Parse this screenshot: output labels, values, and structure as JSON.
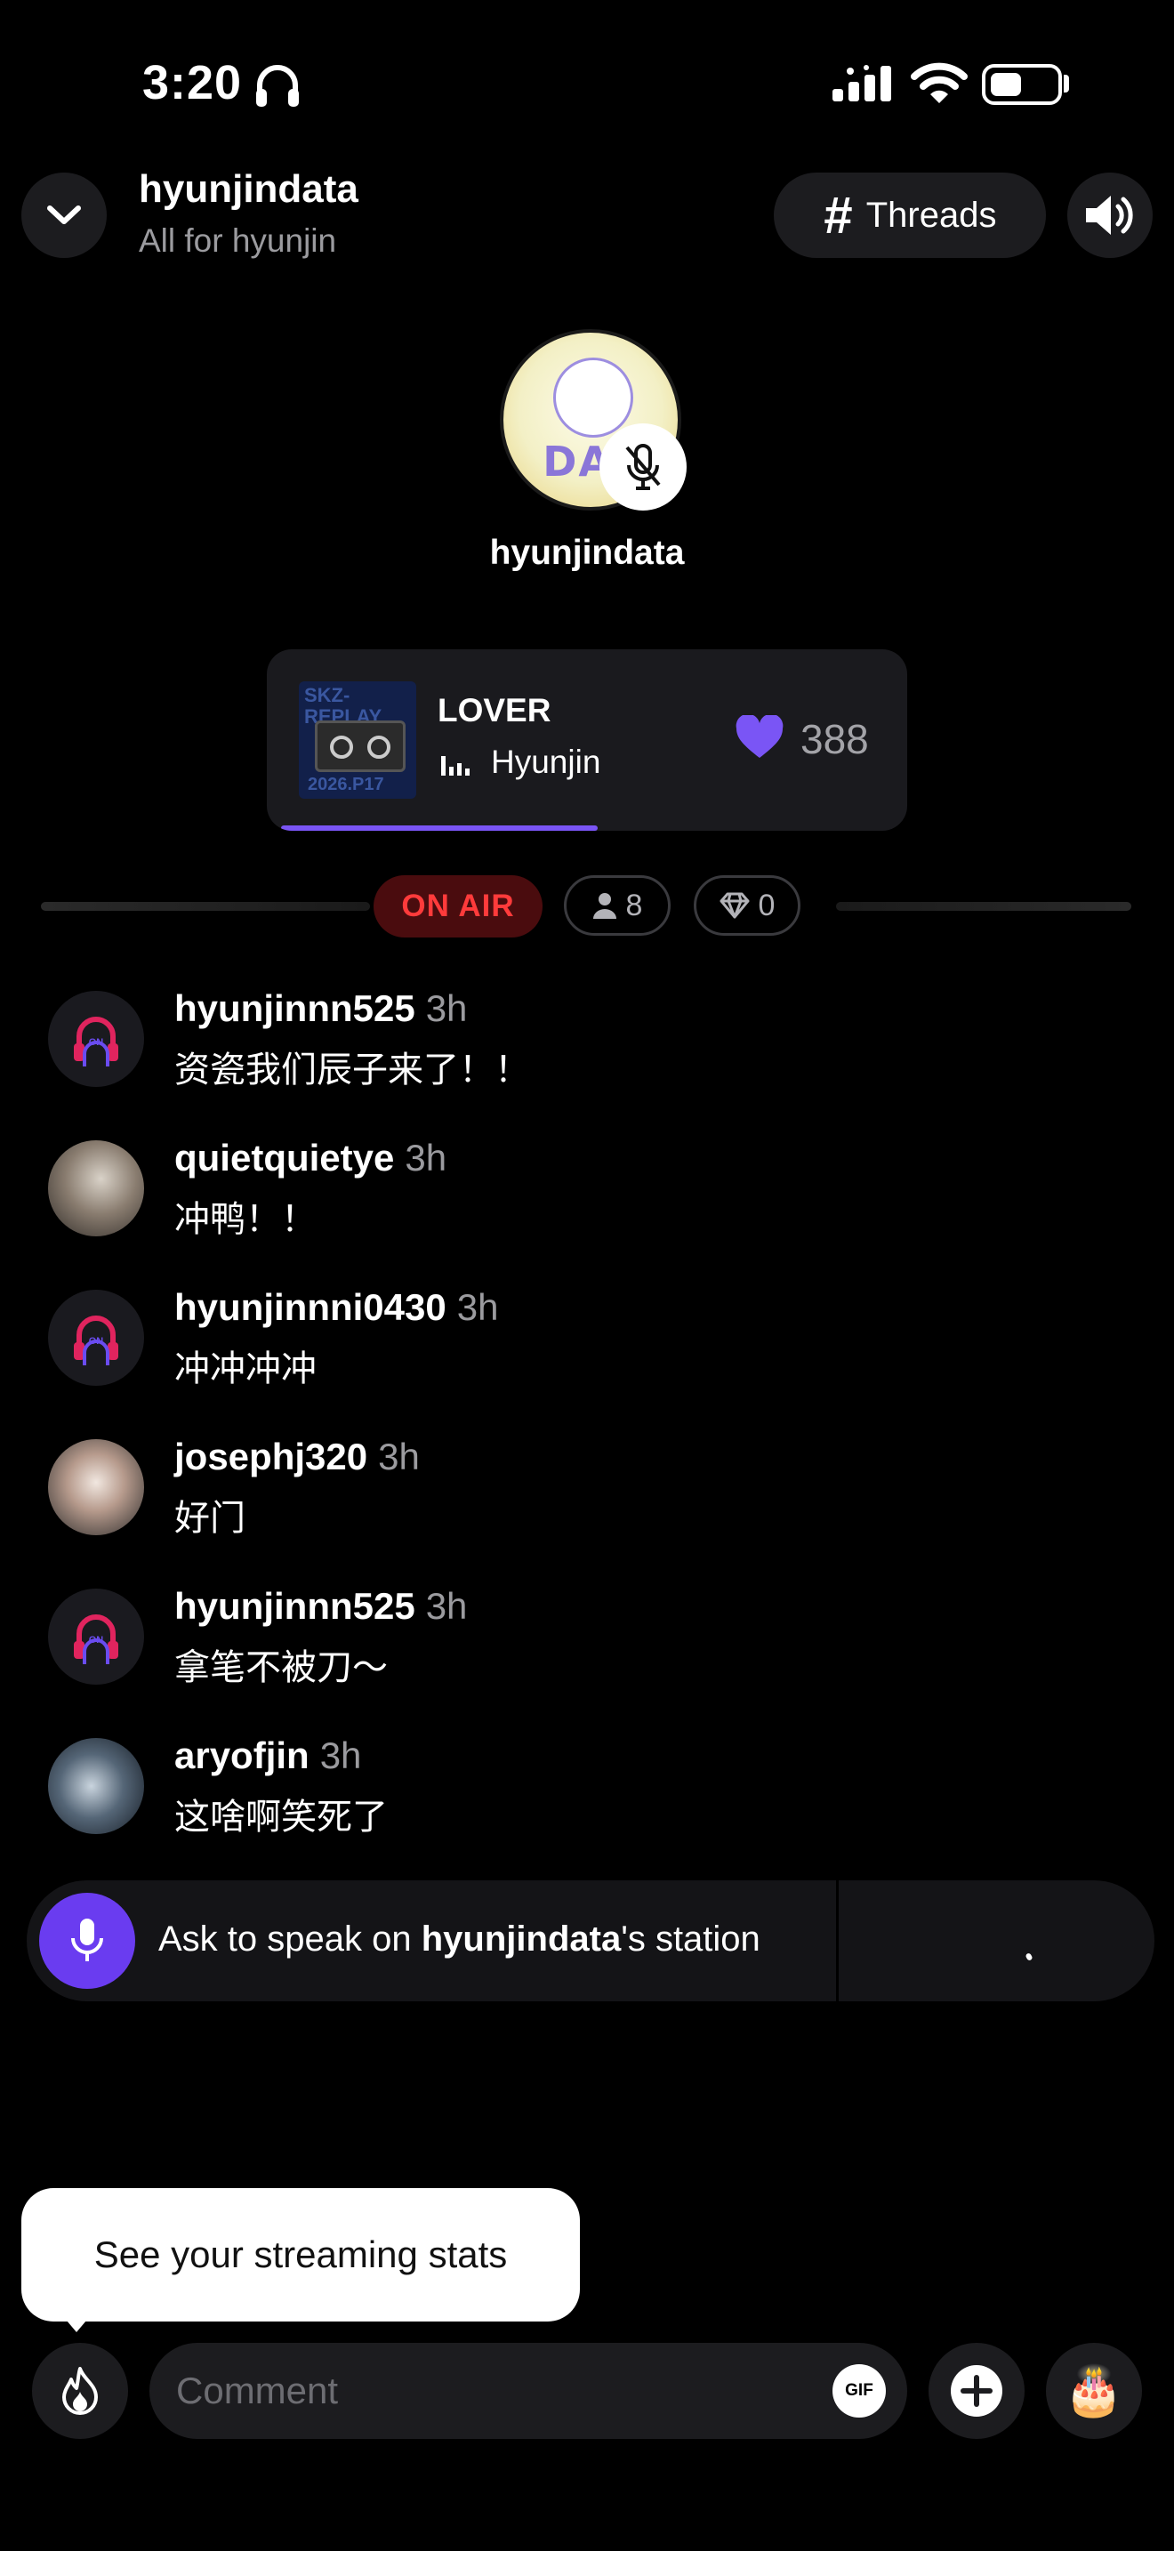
{
  "status_bar": {
    "time": "3:20"
  },
  "header": {
    "title": "hyunjindata",
    "subtitle": "All for hyunjin",
    "threads_label": "Threads"
  },
  "host": {
    "name": "hyunjindata",
    "avatar_text": "DAT",
    "muted": true
  },
  "now_playing": {
    "title": "LOVER",
    "artist": "Hyunjin",
    "likes": "388",
    "progress": 0.52,
    "cover_text_top": "SKZ-REPLAY",
    "cover_text_bottom": "2026.P17"
  },
  "stats": {
    "on_air_label": "ON AIR",
    "listeners": "8",
    "gems": "0"
  },
  "comments": [
    {
      "user": "hyunjinnn525",
      "time": "3h",
      "text": "资瓷我们辰子来了！！",
      "avatar": "logo"
    },
    {
      "user": "quietquietye",
      "time": "3h",
      "text": "冲鸭！！",
      "avatar": "photo1"
    },
    {
      "user": "hyunjinnni0430",
      "time": "3h",
      "text": "冲冲冲冲",
      "avatar": "logo"
    },
    {
      "user": "josephj320",
      "time": "3h",
      "text": "好门",
      "avatar": "photo2"
    },
    {
      "user": "hyunjinnn525",
      "time": "3h",
      "text": "拿笔不被刀～",
      "avatar": "logo"
    },
    {
      "user": "aryofjin",
      "time": "3h",
      "text": "这啥啊笑死了",
      "avatar": "photo3"
    }
  ],
  "ask_to_speak": {
    "prefix": "Ask to speak on ",
    "station": "hyunjindata",
    "suffix": "'s station"
  },
  "tooltip": {
    "text": "See your streaming stats"
  },
  "composer": {
    "placeholder": "Comment",
    "gif_label": "GIF",
    "cake_glyph": "🎂"
  },
  "colors": {
    "accent": "#6a3cf0",
    "on_air": "#ff3b3b",
    "like": "#7a55f5"
  }
}
